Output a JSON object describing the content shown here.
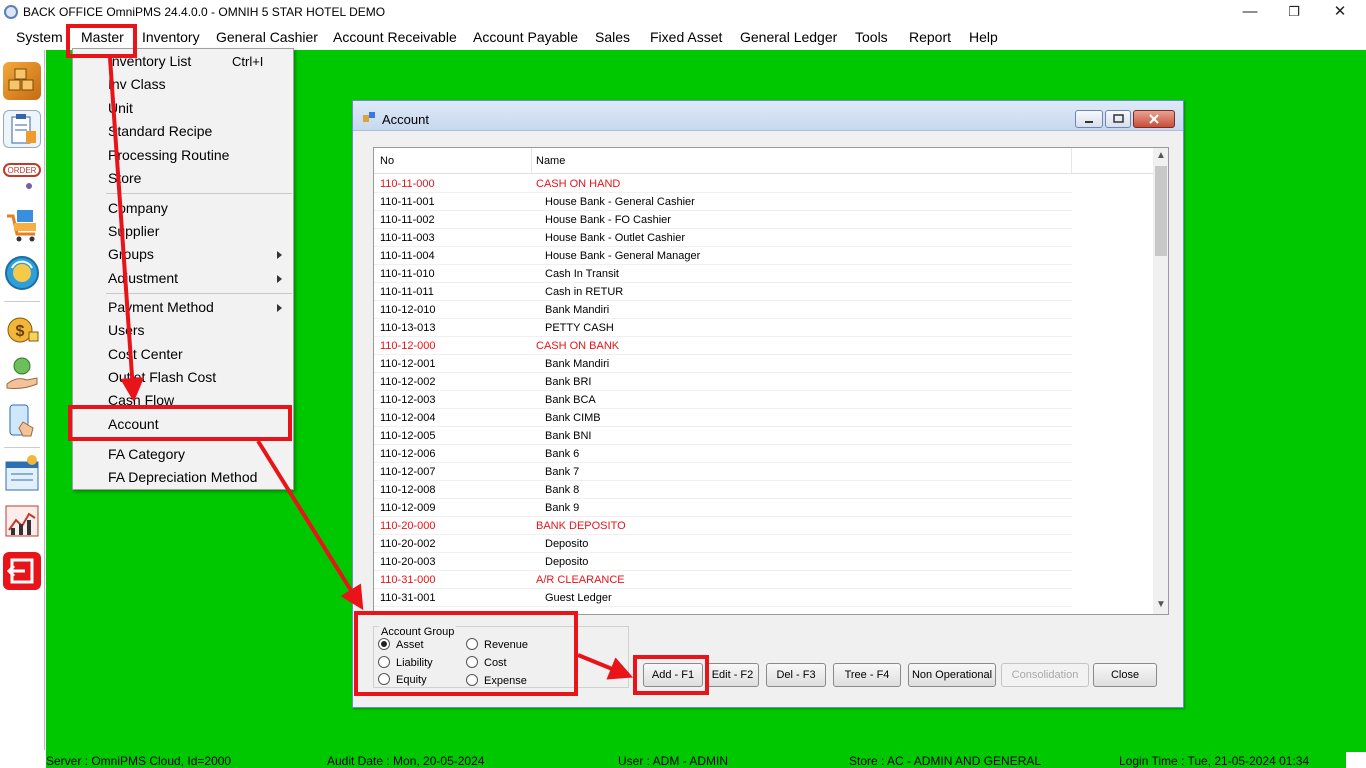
{
  "titlebar": {
    "title": "BACK OFFICE OmniPMS 24.4.0.0 - OMNIH 5 STAR HOTEL DEMO",
    "minimize": "—",
    "restore": "❐",
    "close": "✕"
  },
  "menubar": [
    "System",
    "Master",
    "Inventory",
    "General Cashier",
    "Account Receivable",
    "Account Payable",
    "Sales",
    "Fixed Asset",
    "General Ledger",
    "Tools",
    "Report",
    "Help"
  ],
  "dropdown": {
    "items": [
      {
        "label": "Inventory List",
        "shortcut": "Ctrl+I"
      },
      {
        "label": "Inv Class"
      },
      {
        "label": "Unit"
      },
      {
        "label": "Standard Recipe"
      },
      {
        "label": "Processing Routine"
      },
      {
        "label": "Store"
      },
      {
        "label": "Company"
      },
      {
        "label": "Supplier"
      },
      {
        "label": "Groups",
        "submenu": true
      },
      {
        "label": "Adjustment",
        "submenu": true
      },
      {
        "label": "Payment Method",
        "submenu": true
      },
      {
        "label": "Users"
      },
      {
        "label": "Cost Center"
      },
      {
        "label": "Outlet Flash Cost"
      },
      {
        "label": "Cash Flow"
      },
      {
        "label": "Account"
      },
      {
        "label": "FA Category"
      },
      {
        "label": "FA Depreciation Method"
      }
    ]
  },
  "sidebar": {
    "icons": [
      "warehouse-icon",
      "clipboard-icon",
      "order-icon",
      "cart-icon",
      "sync-icon",
      "money-bag-icon",
      "payment-hand-icon",
      "touch-phone-icon",
      "report-icon",
      "chart-icon",
      "logout-icon"
    ],
    "order_text": "ORDER"
  },
  "account_window": {
    "title": "Account",
    "columns": [
      "No",
      "Name"
    ],
    "rows": [
      {
        "no": "110-11-000",
        "name": "CASH ON HAND",
        "group": true
      },
      {
        "no": "110-11-001",
        "name": "House Bank - General Cashier"
      },
      {
        "no": "110-11-002",
        "name": "House Bank - FO Cashier"
      },
      {
        "no": "110-11-003",
        "name": "House Bank - Outlet Cashier"
      },
      {
        "no": "110-11-004",
        "name": "House Bank - General Manager"
      },
      {
        "no": "110-11-010",
        "name": "Cash In Transit"
      },
      {
        "no": "110-11-011",
        "name": "Cash in RETUR"
      },
      {
        "no": "110-12-010",
        "name": "Bank Mandiri"
      },
      {
        "no": "110-13-013",
        "name": "PETTY CASH"
      },
      {
        "no": "110-12-000",
        "name": "CASH ON BANK",
        "group": true
      },
      {
        "no": "110-12-001",
        "name": "Bank Mandiri"
      },
      {
        "no": "110-12-002",
        "name": "Bank BRI"
      },
      {
        "no": "110-12-003",
        "name": "Bank BCA"
      },
      {
        "no": "110-12-004",
        "name": "Bank CIMB"
      },
      {
        "no": "110-12-005",
        "name": "Bank BNI"
      },
      {
        "no": "110-12-006",
        "name": "Bank 6"
      },
      {
        "no": "110-12-007",
        "name": "Bank 7"
      },
      {
        "no": "110-12-008",
        "name": "Bank 8"
      },
      {
        "no": "110-12-009",
        "name": "Bank 9"
      },
      {
        "no": "110-20-000",
        "name": "BANK DEPOSITO",
        "group": true
      },
      {
        "no": "110-20-002",
        "name": "Deposito"
      },
      {
        "no": "110-20-003",
        "name": "Deposito"
      },
      {
        "no": "110-31-000",
        "name": "A/R CLEARANCE",
        "group": true
      },
      {
        "no": "110-31-001",
        "name": "Guest Ledger"
      }
    ],
    "account_group": {
      "legend": "Account Group",
      "options": [
        "Asset",
        "Liability",
        "Equity",
        "Revenue",
        "Cost",
        "Expense"
      ],
      "selected": "Asset"
    },
    "buttons": [
      "Add - F1",
      "Edit - F2",
      "Del - F3",
      "Tree - F4",
      "Non Operational",
      "Consolidation",
      "Close"
    ]
  },
  "statusbar": {
    "server": "Server : OmniPMS Cloud, Id=2000",
    "audit_date": "Audit Date : Mon, 20-05-2024",
    "user": "User : ADM - ADMIN",
    "store": "Store : AC - ADMIN AND GENERAL",
    "login_time": "Login Time : Tue, 21-05-2024 01:34"
  },
  "colors": {
    "desktop": "#00c800",
    "highlight": "#e8141a",
    "group_row": "#e8141a"
  }
}
